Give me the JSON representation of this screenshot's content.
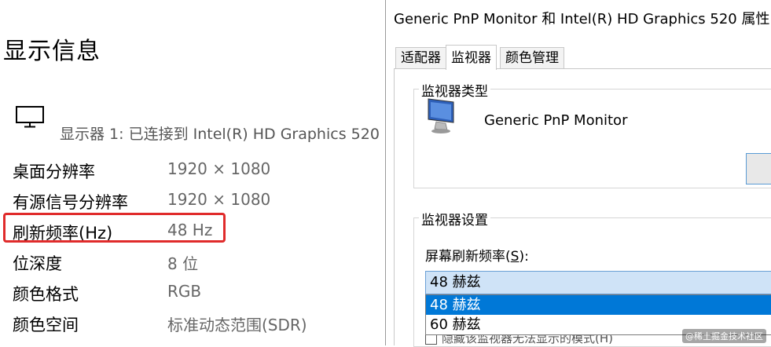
{
  "settings": {
    "title": "显示信息",
    "display_label": "显示器 1: 已连接到 Intel(R) HD Graphics 520",
    "rows": [
      {
        "label": "桌面分辨率",
        "value": "1920 × 1080"
      },
      {
        "label": "有源信号分辨率",
        "value": "1920 × 1080"
      },
      {
        "label": "刷新频率(Hz)",
        "value": "48 Hz"
      },
      {
        "label": "位深度",
        "value": "8 位"
      },
      {
        "label": "颜色格式",
        "value": "RGB"
      },
      {
        "label": "颜色空间",
        "value": "标准动态范围(SDR)"
      }
    ],
    "highlight_color": "#e02b2b"
  },
  "dialog": {
    "title": "Generic PnP Monitor 和 Intel(R) HD Graphics 520 属性",
    "tabs": [
      {
        "label": "适配器"
      },
      {
        "label": "监视器"
      },
      {
        "label": "颜色管理"
      }
    ],
    "active_tab": "监视器",
    "monitor_type_group": "监视器类型",
    "monitor_name": "Generic PnP Monitor",
    "monitor_settings_group": "监视器设置",
    "refresh_label_prefix": "屏幕刷新频率(",
    "refresh_label_key": "S",
    "refresh_label_suffix": "):",
    "refresh_selected": "48 赫兹",
    "refresh_options": [
      "48 赫兹",
      "60 赫兹"
    ],
    "hidden_modes_text": "隐藏该监视器无法显示的模式(H)",
    "selection_color": "#0078d7"
  },
  "watermark": "@稀土掘金技术社区"
}
